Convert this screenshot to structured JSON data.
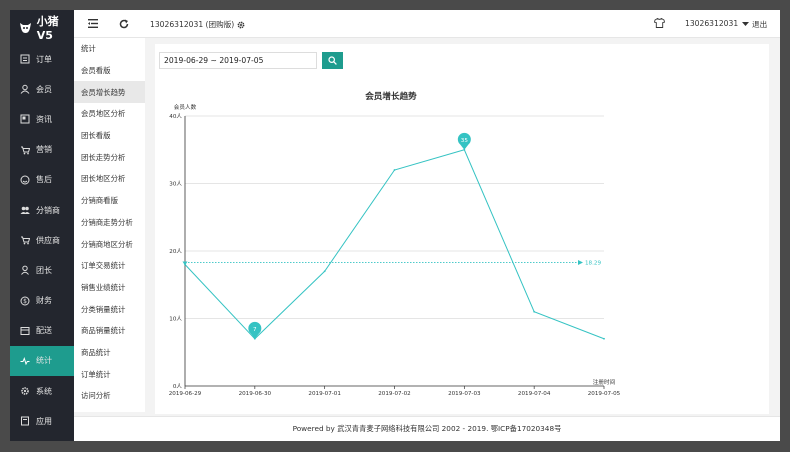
{
  "app": {
    "logo_text": "小猪V5"
  },
  "sidebar": {
    "items": [
      {
        "label": "订单",
        "icon": "order-icon"
      },
      {
        "label": "会员",
        "icon": "member-icon"
      },
      {
        "label": "资讯",
        "icon": "news-icon"
      },
      {
        "label": "营销",
        "icon": "marketing-icon"
      },
      {
        "label": "售后",
        "icon": "aftersale-icon"
      },
      {
        "label": "分销商",
        "icon": "distributor-icon"
      },
      {
        "label": "供应商",
        "icon": "supplier-icon"
      },
      {
        "label": "团长",
        "icon": "leader-icon"
      },
      {
        "label": "财务",
        "icon": "finance-icon"
      },
      {
        "label": "配送",
        "icon": "delivery-icon"
      },
      {
        "label": "统计",
        "icon": "stats-icon",
        "active": true
      },
      {
        "label": "系统",
        "icon": "system-icon"
      },
      {
        "label": "应用",
        "icon": "apps-icon"
      }
    ],
    "active_color": "#1e9c8e"
  },
  "submenu": {
    "header": "统计",
    "items": [
      "会员看版",
      "会员增长趋势",
      "会员地区分析",
      "团长看版",
      "团长走势分析",
      "团长地区分析",
      "分销商看版",
      "分销商走势分析",
      "分销商地区分析",
      "订单交易统计",
      "销售业绩统计",
      "分类销量统计",
      "商品销量统计",
      "商品统计",
      "订单统计",
      "访问分析"
    ],
    "active_index": 1
  },
  "topbar": {
    "store_name": "13026312031 (团购版)",
    "user": "13026312031",
    "logout": "退出"
  },
  "filter": {
    "date_range": "2019-06-29 ~ 2019-07-05"
  },
  "chart_data": {
    "type": "line",
    "title": "会员增长趋势",
    "ylabel": "会员人数",
    "xlabel": "注册时间",
    "x": [
      "2019-06-29",
      "2019-06-30",
      "2019-07-01",
      "2019-07-02",
      "2019-07-03",
      "2019-07-04",
      "2019-07-05"
    ],
    "values": [
      18,
      7,
      17,
      32,
      35,
      11,
      7
    ],
    "ylim": [
      0,
      40
    ],
    "yticks": [
      0,
      10,
      20,
      30,
      40
    ],
    "ytick_labels": [
      "0人",
      "10人",
      "20人",
      "30人",
      "40人"
    ],
    "markpoints": [
      {
        "index": 1,
        "label": "7"
      },
      {
        "index": 4,
        "label": "35"
      }
    ],
    "average": {
      "value": 18.29,
      "label": "18.29"
    },
    "color": "#35c3c3",
    "grid": "horizontal"
  },
  "footer": {
    "text": "Powered by 武汉青青麦子网络科技有限公司 2002 - 2019. 鄂ICP备17020348号"
  }
}
